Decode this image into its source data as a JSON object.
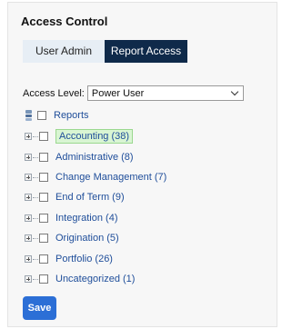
{
  "panel": {
    "title": "Access Control"
  },
  "tabs": [
    {
      "label": "User Admin",
      "active": false
    },
    {
      "label": "Report Access",
      "active": true
    }
  ],
  "access_level": {
    "label": "Access Level:",
    "selected": "Power User"
  },
  "tree": {
    "root": {
      "label": "Reports",
      "icon": "reports-stack-icon"
    },
    "items": [
      {
        "label": "Accounting (38)",
        "selected": true
      },
      {
        "label": "Administrative (8)"
      },
      {
        "label": "Change Management (7)"
      },
      {
        "label": "End of Term (9)"
      },
      {
        "label": "Integration (4)"
      },
      {
        "label": "Origination (5)"
      },
      {
        "label": "Portfolio (26)"
      },
      {
        "label": "Uncategorized (1)"
      }
    ]
  },
  "actions": {
    "save_label": "Save"
  },
  "colors": {
    "active_tab": "#0f2a4a",
    "inactive_tab": "#e7eef5",
    "link": "#1f4e9a",
    "selected_bg": "#d9f5d3",
    "save_button": "#2c6fd6"
  }
}
